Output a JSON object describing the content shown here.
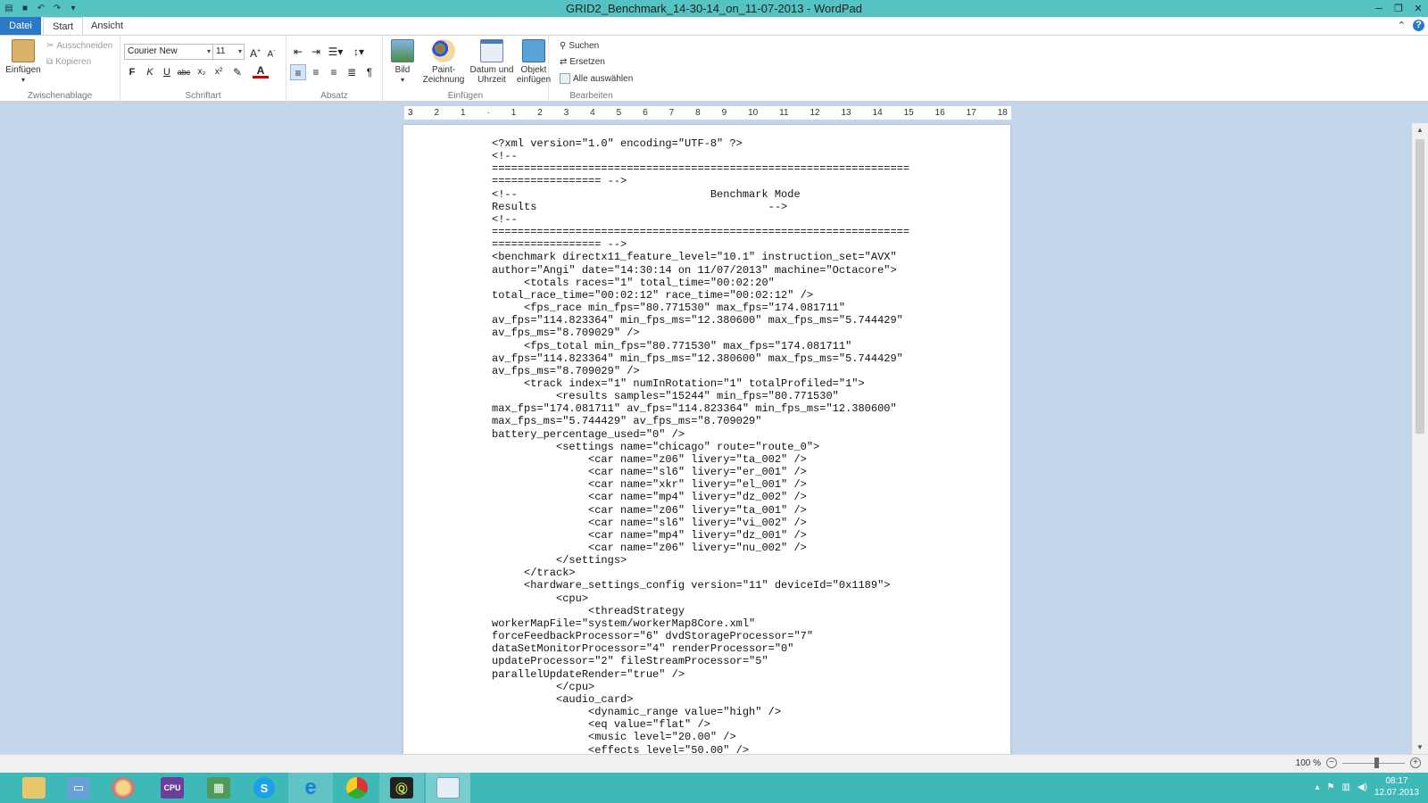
{
  "window": {
    "title": "GRID2_Benchmark_14-30-14_on_11-07-2013 - WordPad"
  },
  "tabs": {
    "file": "Datei",
    "start": "Start",
    "view": "Ansicht"
  },
  "ribbon": {
    "clipboard": {
      "paste": "Einfügen",
      "cut": "Ausschneiden",
      "copy": "Kopieren",
      "label": "Zwischenablage"
    },
    "font": {
      "family": "Courier New",
      "size": "11",
      "bold": "F",
      "italic": "K",
      "underline": "U",
      "strike": "abc",
      "subscript": "x₂",
      "superscript": "x²",
      "label": "Schriftart"
    },
    "paragraph": {
      "label": "Absatz"
    },
    "insert": {
      "picture": "Bild",
      "paint_line1": "Paint-",
      "paint_line2": "Zeichnung",
      "datetime_line1": "Datum und",
      "datetime_line2": "Uhrzeit",
      "object_line1": "Objekt",
      "object_line2": "einfügen",
      "label": "Einfügen"
    },
    "edit": {
      "find": "Suchen",
      "replace": "Ersetzen",
      "select_all": "Alle auswählen",
      "label": "Bearbeiten"
    }
  },
  "ruler": {
    "ticks": [
      "3",
      "2",
      "1",
      "",
      "1",
      "2",
      "3",
      "4",
      "5",
      "6",
      "7",
      "8",
      "9",
      "10",
      "11",
      "12",
      "13",
      "14",
      "15",
      "16",
      "17",
      "18"
    ]
  },
  "document": {
    "lines": [
      "<?xml version=\"1.0\" encoding=\"UTF-8\" ?>",
      "<!--",
      "=================================================================",
      "================= -->",
      "<!--                              Benchmark Mode",
      "Results                                    -->",
      "<!--",
      "=================================================================",
      "================= -->",
      "<benchmark directx11_feature_level=\"10.1\" instruction_set=\"AVX\"",
      "author=\"Angi\" date=\"14:30:14 on 11/07/2013\" machine=\"Octacore\">",
      "     <totals races=\"1\" total_time=\"00:02:20\"",
      "total_race_time=\"00:02:12\" race_time=\"00:02:12\" />",
      "     <fps_race min_fps=\"80.771530\" max_fps=\"174.081711\"",
      "av_fps=\"114.823364\" min_fps_ms=\"12.380600\" max_fps_ms=\"5.744429\"",
      "av_fps_ms=\"8.709029\" />",
      "     <fps_total min_fps=\"80.771530\" max_fps=\"174.081711\"",
      "av_fps=\"114.823364\" min_fps_ms=\"12.380600\" max_fps_ms=\"5.744429\"",
      "av_fps_ms=\"8.709029\" />",
      "     <track index=\"1\" numInRotation=\"1\" totalProfiled=\"1\">",
      "          <results samples=\"15244\" min_fps=\"80.771530\"",
      "max_fps=\"174.081711\" av_fps=\"114.823364\" min_fps_ms=\"12.380600\"",
      "max_fps_ms=\"5.744429\" av_fps_ms=\"8.709029\"",
      "battery_percentage_used=\"0\" />",
      "          <settings name=\"chicago\" route=\"route_0\">",
      "               <car name=\"z06\" livery=\"ta_002\" />",
      "               <car name=\"sl6\" livery=\"er_001\" />",
      "               <car name=\"xkr\" livery=\"el_001\" />",
      "               <car name=\"mp4\" livery=\"dz_002\" />",
      "               <car name=\"z06\" livery=\"ta_001\" />",
      "               <car name=\"sl6\" livery=\"vi_002\" />",
      "               <car name=\"mp4\" livery=\"dz_001\" />",
      "               <car name=\"z06\" livery=\"nu_002\" />",
      "          </settings>",
      "     </track>",
      "     <hardware_settings_config version=\"11\" deviceId=\"0x1189\">",
      "          <cpu>",
      "               <threadStrategy",
      "workerMapFile=\"system/workerMap8Core.xml\"",
      "forceFeedbackProcessor=\"6\" dvdStorageProcessor=\"7\"",
      "dataSetMonitorProcessor=\"4\" renderProcessor=\"0\"",
      "updateProcessor=\"2\" fileStreamProcessor=\"5\"",
      "parallelUpdateRender=\"true\" />",
      "          </cpu>",
      "          <audio_card>",
      "               <dynamic_range value=\"high\" />",
      "               <eq value=\"flat\" />",
      "               <music level=\"20.00\" />",
      "               <effects level=\"50.00\" />"
    ]
  },
  "status": {
    "zoom": "100 %"
  },
  "taskbar": {
    "clock_time": "08:17",
    "clock_date": "12.07.2013"
  },
  "colors": {
    "titlebar": "#55c3c3",
    "file_tab": "#2b79c6",
    "taskbar": "#3fb8b8",
    "workspace": "#c4d6ec"
  }
}
